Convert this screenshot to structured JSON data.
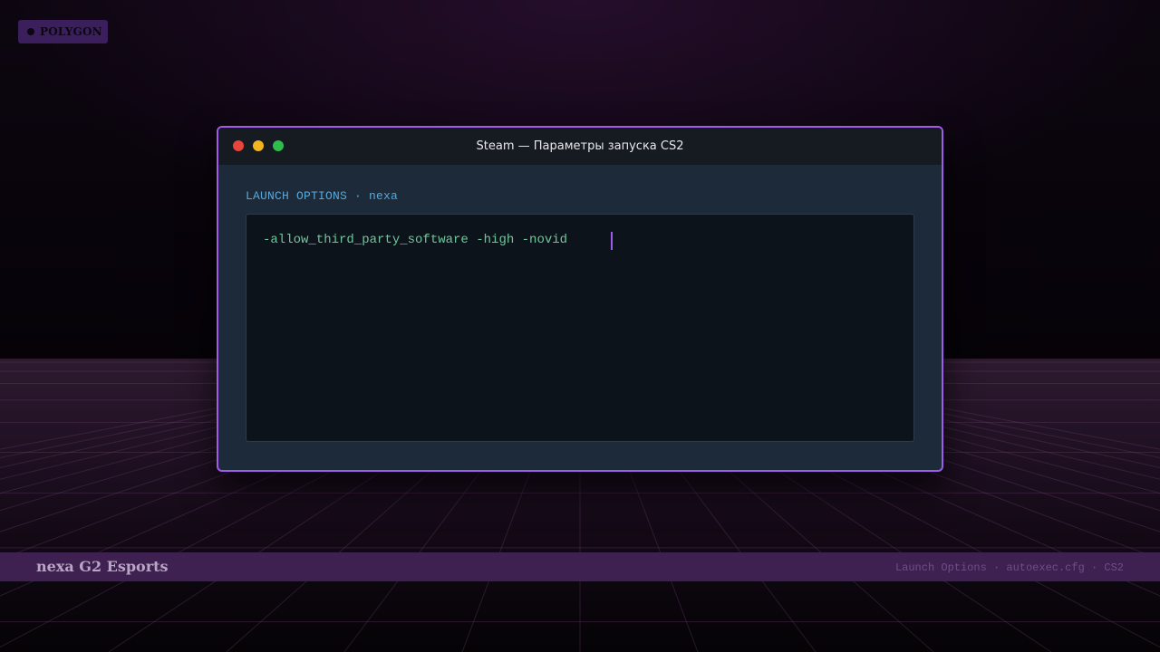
{
  "logo": {
    "text": "POLYGON"
  },
  "window": {
    "title": "Steam — Параметры запуска CS2",
    "options_label": "LAUNCH OPTIONS · nexa",
    "launch_options_value": "-allow_third_party_software -high -novid"
  },
  "banner": {
    "title": "nexa G2 Esports",
    "subtitle": "Launch Options · autoexec.cfg · CS2"
  },
  "colors": {
    "accent": "#a05ce8",
    "command_text": "#6fc89a",
    "label_text": "#5aa8d8",
    "close": "#e8453c",
    "minimize": "#f2b51f",
    "maximize": "#2fbd4e"
  },
  "icons": [
    "close-dot-icon",
    "minimize-dot-icon",
    "maximize-dot-icon",
    "logo-dot-icon"
  ]
}
